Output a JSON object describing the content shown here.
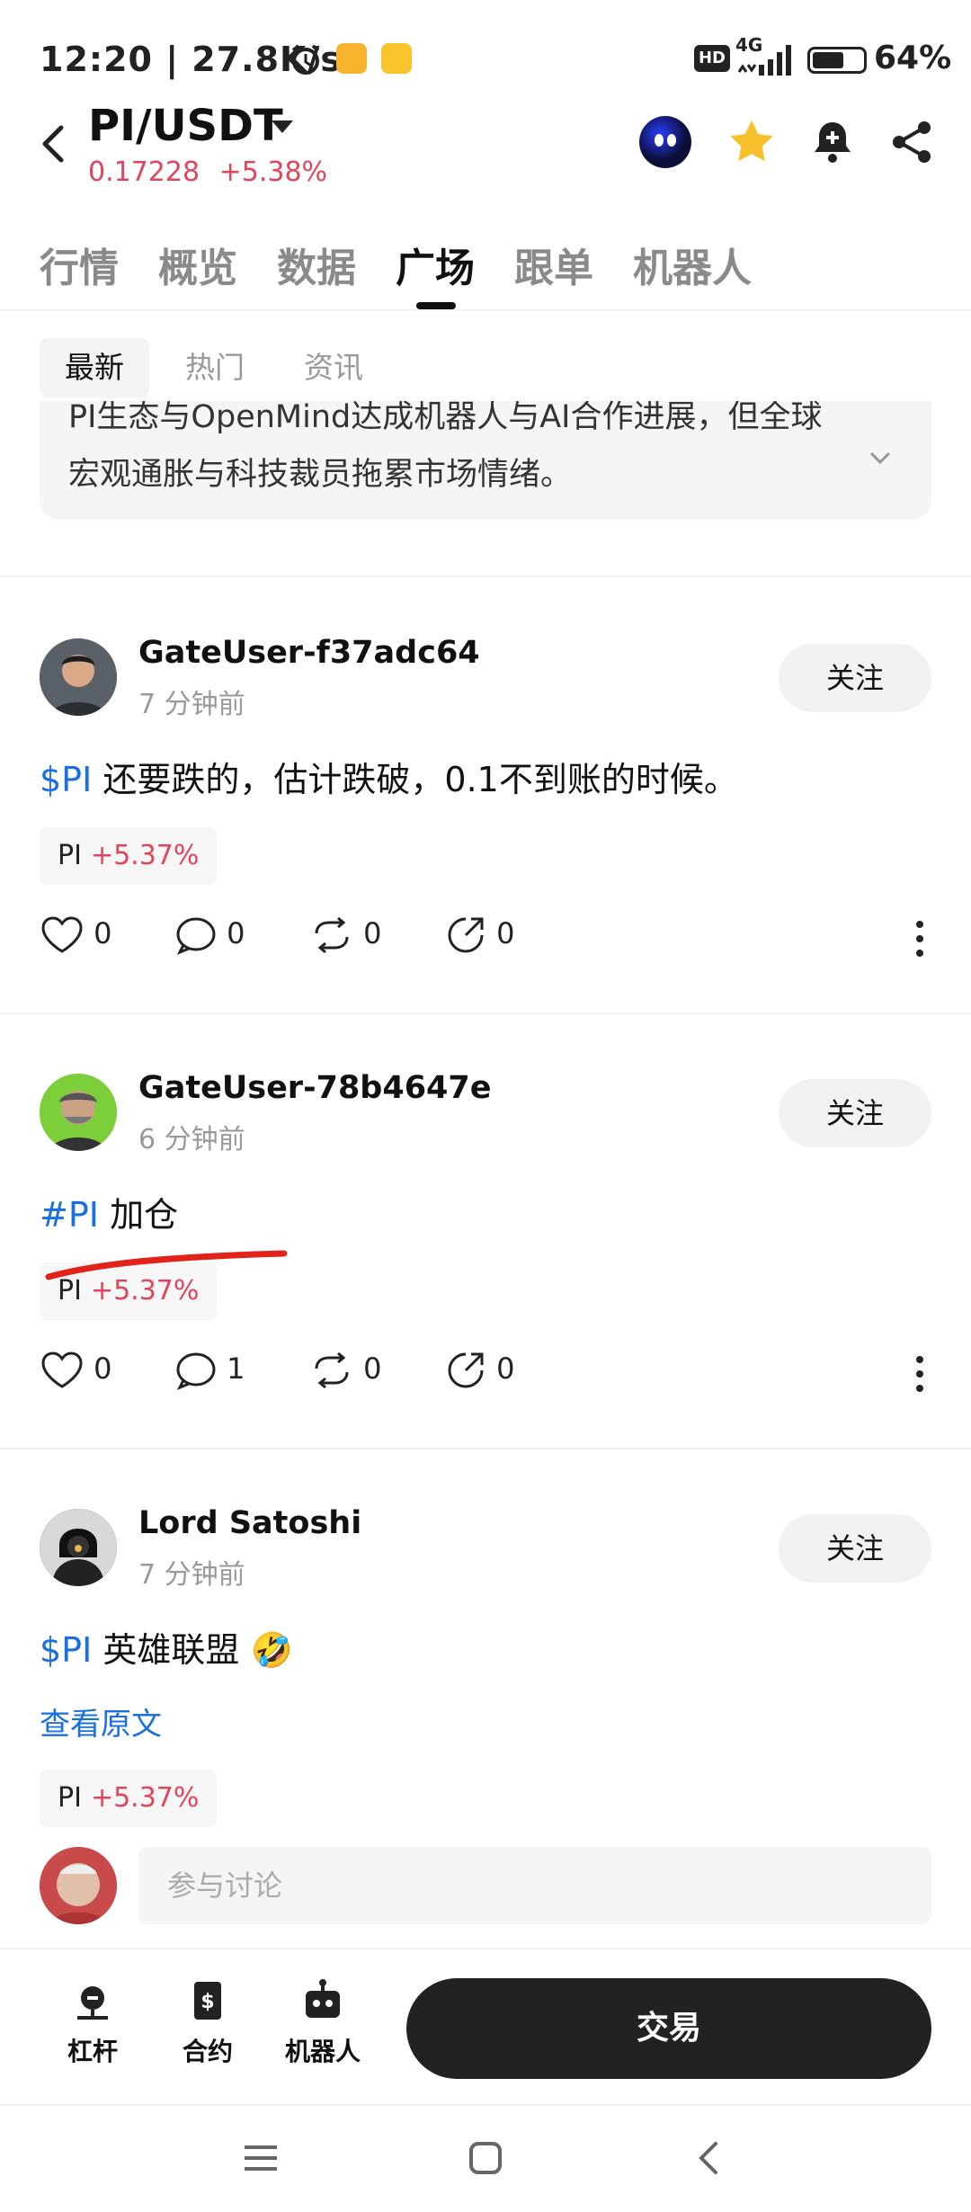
{
  "status_bar": {
    "time_speed": "12:20 | 27.8K/s",
    "network": "4G",
    "hd": "HD",
    "battery": "64%"
  },
  "header": {
    "pair": "PI/USDT",
    "price": "0.17228",
    "change": "+5.38%",
    "icons": [
      "ghost-app-icon",
      "star-icon",
      "bell-add-icon",
      "share-icon"
    ]
  },
  "tabs": [
    "行情",
    "概览",
    "数据",
    "广场",
    "跟单",
    "机器人"
  ],
  "active_tab": "广场",
  "sub_tabs": [
    "最新",
    "热门",
    "资讯"
  ],
  "summary": {
    "line1": "PI生态与OpenMind达成机器人与AI合作进展，但全球",
    "line2": "宏观通胀与科技裁员拖累市场情绪。"
  },
  "posts": [
    {
      "user": "GateUser-f37adc64",
      "time": "7 分钟前",
      "follow": "关注",
      "tag": "$PI",
      "text": "还要跌的，估计跌破，0.1不到账的时候。",
      "chip_coin": "PI",
      "chip_pct": "+5.37%",
      "likes": "0",
      "comments": "0",
      "reposts": "0",
      "shares": "0"
    },
    {
      "user": "GateUser-78b4647e",
      "time": "6 分钟前",
      "follow": "关注",
      "tag": "#PI",
      "text": "加仓",
      "chip_coin": "PI",
      "chip_pct": "+5.37%",
      "likes": "0",
      "comments": "1",
      "reposts": "0",
      "shares": "0"
    },
    {
      "user": "Lord Satoshi",
      "time": "7 分钟前",
      "follow": "关注",
      "tag": "$PI",
      "text": "英雄联盟 🤣",
      "link": "查看原文",
      "chip_coin": "PI",
      "chip_pct": "+5.37%"
    }
  ],
  "comment_placeholder": "参与讨论",
  "bottom_nav": {
    "leverage": "杠杆",
    "contract": "合约",
    "robot": "机器人",
    "trade": "交易"
  },
  "colors": {
    "accent_red": "#e0455c",
    "link_blue": "#1a6fe0",
    "trade_button": "#222222"
  }
}
